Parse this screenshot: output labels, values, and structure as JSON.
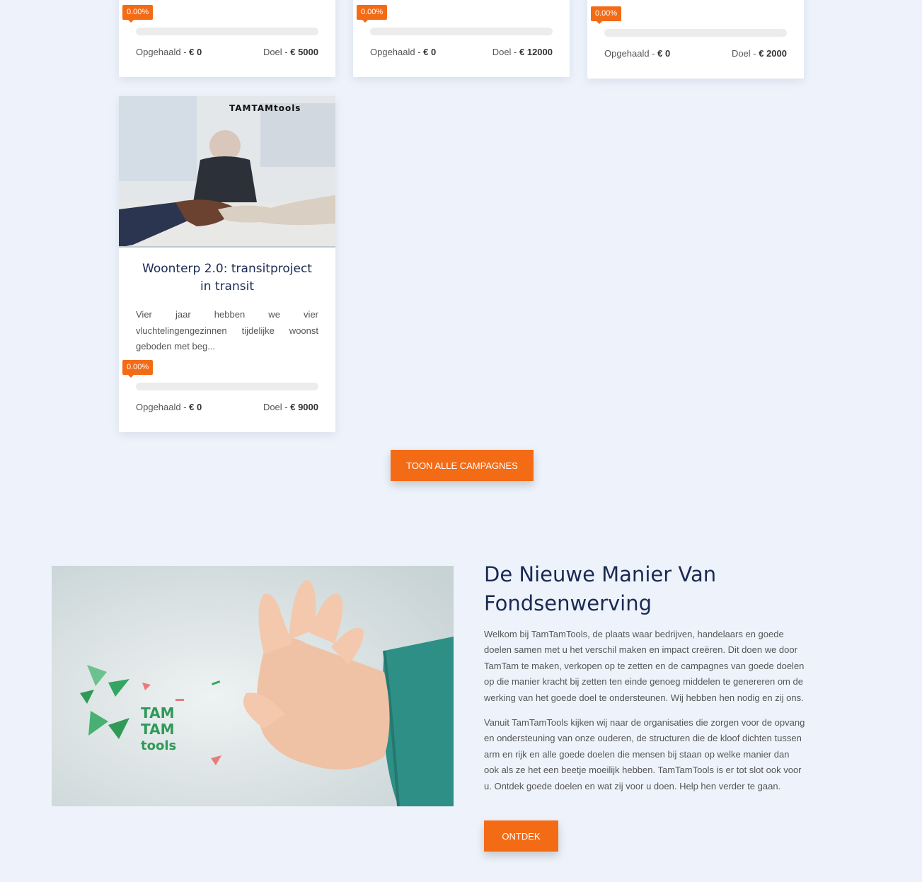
{
  "campaigns": [
    {
      "progress_label": "0.00%",
      "progress": 0,
      "raised_label": "Opgehaald - ",
      "raised_value": "€ 0",
      "goal_label": "Doel - ",
      "goal_value": "€ 5000"
    },
    {
      "progress_label": "0.00%",
      "progress": 0,
      "raised_label": "Opgehaald - ",
      "raised_value": "€ 0",
      "goal_label": "Doel - ",
      "goal_value": "€ 12000"
    },
    {
      "progress_label": "0.00%",
      "progress": 0,
      "raised_label": "Opgehaald - ",
      "raised_value": "€ 0",
      "goal_label": "Doel - ",
      "goal_value": "€ 2000"
    },
    {
      "title": "Woonterp 2.0: transitproject in transit",
      "excerpt": "Vier jaar hebben we vier vluchtelingengezinnen tijdelijke woonst geboden met beg...",
      "image_logo_text": "TAMTAMtools",
      "progress_label": "0.00%",
      "progress": 0,
      "raised_label": "Opgehaald - ",
      "raised_value": "€ 0",
      "goal_label": "Doel - ",
      "goal_value": "€ 9000"
    }
  ],
  "show_all_button": "TOON ALLE CAMPAGNES",
  "about": {
    "title": "De Nieuwe Manier Van Fondsenwerving",
    "paragraph1": "Welkom bij TamTamTools, de plaats waar bedrijven, handelaars en goede doelen samen met u het verschil maken en impact creëren. Dit doen we door TamTam te maken, verkopen op te zetten en de campagnes van goede doelen op die manier kracht bij zetten ten einde genoeg middelen te genereren om de werking van het goede doel te ondersteunen. Wij hebben hen nodig en zij ons.",
    "paragraph2": "Vanuit TamTamTools kijken wij naar de organisaties die zorgen voor de opvang en ondersteuning van onze ouderen, de structuren die de kloof dichten tussen arm en rijk en alle goede doelen die mensen bij staan op welke manier dan ook als ze het een beetje moeilijk hebben. TamTamTools is er tot slot ook voor u. Ontdek goede doelen en wat zij voor u doen. Help hen verder te gaan.",
    "button": "ONTDEK",
    "logo_lines": [
      "TAM",
      "TAM",
      "tools"
    ]
  },
  "colors": {
    "accent": "#f46b16",
    "heading": "#1a2a52",
    "background": "#eef3fb",
    "logo_green": "#2f9a58"
  }
}
